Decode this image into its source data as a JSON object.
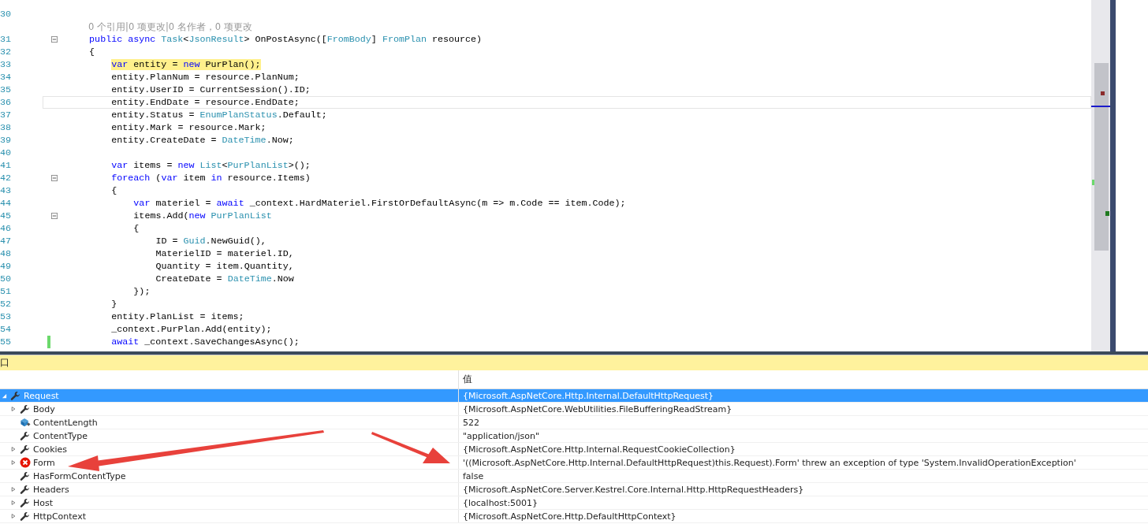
{
  "editor": {
    "lines": [
      {
        "kind": "code",
        "number": "30",
        "highlighted": false,
        "current": false,
        "changed": false,
        "foldable": false
      },
      {
        "kind": "codelens",
        "text": "0 个引用|0 项更改|0 名作者，0 项更改"
      },
      {
        "kind": "code",
        "number": "31",
        "highlighted": false,
        "current": false,
        "changed": false,
        "foldable": true,
        "tokens": [
          {
            "kind": "keyword",
            "text": "public async"
          },
          {
            "kind": "type",
            "text": " Task"
          },
          {
            "kind": "plain",
            "text": "<"
          },
          {
            "kind": "type",
            "text": "JsonResult"
          },
          {
            "kind": "plain",
            "text": "> OnPostAsync(["
          },
          {
            "kind": "type",
            "text": "FromBody"
          },
          {
            "kind": "plain",
            "text": "] "
          },
          {
            "kind": "type",
            "text": "FromPlan"
          },
          {
            "kind": "plain",
            "text": " resource)"
          }
        ]
      },
      {
        "kind": "code",
        "number": "32",
        "highlighted": false,
        "current": false,
        "changed": false,
        "foldable": false,
        "tokens": [
          {
            "kind": "plain",
            "text": "{"
          }
        ],
        "children": [
          {
            "kind": "code",
            "number": "33",
            "highlighted": true,
            "current": false,
            "changed": false,
            "foldable": false,
            "tokens": [
              {
                "kind": "keyword",
                "text": "var"
              },
              {
                "kind": "plain",
                "text": " entity = "
              },
              {
                "kind": "keyword",
                "text": "new"
              },
              {
                "kind": "plain",
                "text": " PurPlan();"
              }
            ]
          },
          {
            "kind": "code",
            "number": "34",
            "highlighted": false,
            "current": false,
            "changed": false,
            "foldable": false,
            "tokens": [
              {
                "kind": "plain",
                "text": "entity.PlanNum = resource.PlanNum;"
              }
            ]
          },
          {
            "kind": "code",
            "number": "35",
            "highlighted": false,
            "current": false,
            "changed": false,
            "foldable": false,
            "tokens": [
              {
                "kind": "plain",
                "text": "entity.UserID = CurrentSession().ID;"
              }
            ]
          },
          {
            "kind": "code",
            "number": "36",
            "highlighted": false,
            "current": true,
            "changed": false,
            "foldable": false,
            "tokens": [
              {
                "kind": "plain",
                "text": "entity.EndDate = resource.EndDate;"
              }
            ]
          },
          {
            "kind": "code",
            "number": "37",
            "highlighted": false,
            "current": false,
            "changed": false,
            "foldable": false,
            "tokens": [
              {
                "kind": "plain",
                "text": "entity.Status = "
              },
              {
                "kind": "type",
                "text": "EnumPlanStatus"
              },
              {
                "kind": "plain",
                "text": ".Default;"
              }
            ]
          },
          {
            "kind": "code",
            "number": "38",
            "highlighted": false,
            "current": false,
            "changed": false,
            "foldable": false,
            "tokens": [
              {
                "kind": "plain",
                "text": "entity.Mark = resource.Mark;"
              }
            ]
          },
          {
            "kind": "code",
            "number": "39",
            "highlighted": false,
            "current": false,
            "changed": false,
            "foldable": false,
            "tokens": [
              {
                "kind": "plain",
                "text": "entity.CreateDate = "
              },
              {
                "kind": "type",
                "text": "DateTime"
              },
              {
                "kind": "plain",
                "text": ".Now;"
              }
            ]
          },
          {
            "kind": "code",
            "number": "40",
            "highlighted": false,
            "current": false,
            "changed": false,
            "foldable": false
          },
          {
            "kind": "code",
            "number": "41",
            "highlighted": false,
            "current": false,
            "changed": false,
            "foldable": false,
            "tokens": [
              {
                "kind": "keyword",
                "text": "var"
              },
              {
                "kind": "plain",
                "text": " items = "
              },
              {
                "kind": "keyword",
                "text": "new"
              },
              {
                "kind": "type",
                "text": " List"
              },
              {
                "kind": "plain",
                "text": "<"
              },
              {
                "kind": "type",
                "text": "PurPlanList"
              },
              {
                "kind": "plain",
                "text": ">();"
              }
            ]
          },
          {
            "kind": "code",
            "number": "42",
            "highlighted": false,
            "current": false,
            "changed": false,
            "foldable": true,
            "tokens": [
              {
                "kind": "keyword",
                "text": "foreach"
              },
              {
                "kind": "plain",
                "text": " ("
              },
              {
                "kind": "keyword",
                "text": "var"
              },
              {
                "kind": "plain",
                "text": " item "
              },
              {
                "kind": "keyword",
                "text": "in"
              },
              {
                "kind": "plain",
                "text": " resource.Items)"
              }
            ]
          },
          {
            "kind": "code",
            "number": "43",
            "highlighted": false,
            "current": false,
            "changed": false,
            "foldable": false,
            "tokens": [
              {
                "kind": "plain",
                "text": "{"
              }
            ],
            "children": [
              {
                "kind": "code",
                "number": "44",
                "highlighted": false,
                "current": false,
                "changed": false,
                "foldable": false,
                "tokens": [
                  {
                    "kind": "keyword",
                    "text": "var"
                  },
                  {
                    "kind": "plain",
                    "text": " materiel = "
                  },
                  {
                    "kind": "keyword",
                    "text": "await"
                  },
                  {
                    "kind": "plain",
                    "text": " _context.HardMateriel.FirstOrDefaultAsync(m => m.Code == item.Code);"
                  }
                ]
              },
              {
                "kind": "code",
                "number": "45",
                "highlighted": false,
                "current": false,
                "changed": false,
                "foldable": true,
                "tokens": [
                  {
                    "kind": "plain",
                    "text": "items.Add("
                  },
                  {
                    "kind": "keyword",
                    "text": "new"
                  },
                  {
                    "kind": "type",
                    "text": " PurPlanList"
                  }
                ]
              },
              {
                "kind": "code",
                "number": "46",
                "highlighted": false,
                "current": false,
                "changed": false,
                "foldable": false,
                "tokens": [
                  {
                    "kind": "plain",
                    "text": "{"
                  }
                ],
                "children": [
                  {
                    "kind": "code",
                    "number": "47",
                    "highlighted": false,
                    "current": false,
                    "changed": false,
                    "foldable": false,
                    "tokens": [
                      {
                        "kind": "plain",
                        "text": "ID = "
                      },
                      {
                        "kind": "type",
                        "text": "Guid"
                      },
                      {
                        "kind": "plain",
                        "text": ".NewGuid(),"
                      }
                    ]
                  },
                  {
                    "kind": "code",
                    "number": "48",
                    "highlighted": false,
                    "current": false,
                    "changed": false,
                    "foldable": false,
                    "tokens": [
                      {
                        "kind": "plain",
                        "text": "MaterielID = materiel.ID,"
                      }
                    ]
                  },
                  {
                    "kind": "code",
                    "number": "49",
                    "highlighted": false,
                    "current": false,
                    "changed": false,
                    "foldable": false,
                    "tokens": [
                      {
                        "kind": "plain",
                        "text": "Quantity = item.Quantity,"
                      }
                    ]
                  },
                  {
                    "kind": "code",
                    "number": "50",
                    "highlighted": false,
                    "current": false,
                    "changed": false,
                    "foldable": false,
                    "tokens": [
                      {
                        "kind": "plain",
                        "text": "CreateDate = "
                      },
                      {
                        "kind": "type",
                        "text": "DateTime"
                      },
                      {
                        "kind": "plain",
                        "text": ".Now"
                      }
                    ]
                  }
                ]
              },
              {
                "kind": "code",
                "number": "51",
                "highlighted": false,
                "current": false,
                "changed": false,
                "foldable": false,
                "tokens": [
                  {
                    "kind": "plain",
                    "text": "});"
                  }
                ]
              }
            ]
          },
          {
            "kind": "code",
            "number": "52",
            "highlighted": false,
            "current": false,
            "changed": false,
            "foldable": false,
            "tokens": [
              {
                "kind": "plain",
                "text": "}"
              }
            ]
          },
          {
            "kind": "code",
            "number": "53",
            "highlighted": false,
            "current": false,
            "changed": false,
            "foldable": false,
            "tokens": [
              {
                "kind": "plain",
                "text": "entity.PlanList = items;"
              }
            ]
          },
          {
            "kind": "code",
            "number": "54",
            "highlighted": false,
            "current": false,
            "changed": false,
            "foldable": false,
            "tokens": [
              {
                "kind": "plain",
                "text": "_context.PurPlan.Add(entity);"
              }
            ]
          },
          {
            "kind": "code",
            "number": "55",
            "highlighted": false,
            "current": false,
            "changed": true,
            "foldable": false,
            "tokens": [
              {
                "kind": "keyword",
                "text": "await"
              },
              {
                "kind": "plain",
                "text": " _context.SaveChangesAsync();"
              }
            ]
          }
        ]
      }
    ]
  },
  "watch_panel": {
    "title": "口",
    "value_header": "值",
    "rows": [
      {
        "name": "Request",
        "value": "{Microsoft.AspNetCore.Http.Internal.DefaultHttpRequest}",
        "kind": "property",
        "expandable": true,
        "expanded": true,
        "selected": true,
        "children": [
          {
            "name": "Body",
            "value": "{Microsoft.AspNetCore.WebUtilities.FileBufferingReadStream}",
            "kind": "property",
            "expandable": true,
            "expanded": false,
            "selected": false
          },
          {
            "name": "ContentLength",
            "value": "522",
            "kind": "field",
            "expandable": false,
            "selected": false
          },
          {
            "name": "ContentType",
            "value": "\"application/json\"",
            "kind": "property",
            "expandable": false,
            "selected": false
          },
          {
            "name": "Cookies",
            "value": "{Microsoft.AspNetCore.Http.Internal.RequestCookieCollection}",
            "kind": "property",
            "expandable": true,
            "expanded": false,
            "selected": false
          },
          {
            "name": "Form",
            "value": "'((Microsoft.AspNetCore.Http.Internal.DefaultHttpRequest)this.Request).Form' threw an exception of type 'System.InvalidOperationException'",
            "kind": "error",
            "expandable": true,
            "expanded": false,
            "selected": false
          },
          {
            "name": "HasFormContentType",
            "value": "false",
            "kind": "property",
            "expandable": false,
            "selected": false
          },
          {
            "name": "Headers",
            "value": "{Microsoft.AspNetCore.Server.Kestrel.Core.Internal.Http.HttpRequestHeaders}",
            "kind": "property",
            "expandable": true,
            "expanded": false,
            "selected": false
          },
          {
            "name": "Host",
            "value": "{localhost:5001}",
            "kind": "property",
            "expandable": true,
            "expanded": false,
            "selected": false
          },
          {
            "name": "HttpContext",
            "value": "{Microsoft.AspNetCore.Http.DefaultHttpContext}",
            "kind": "property",
            "expandable": true,
            "expanded": false,
            "selected": false
          }
        ]
      }
    ]
  }
}
